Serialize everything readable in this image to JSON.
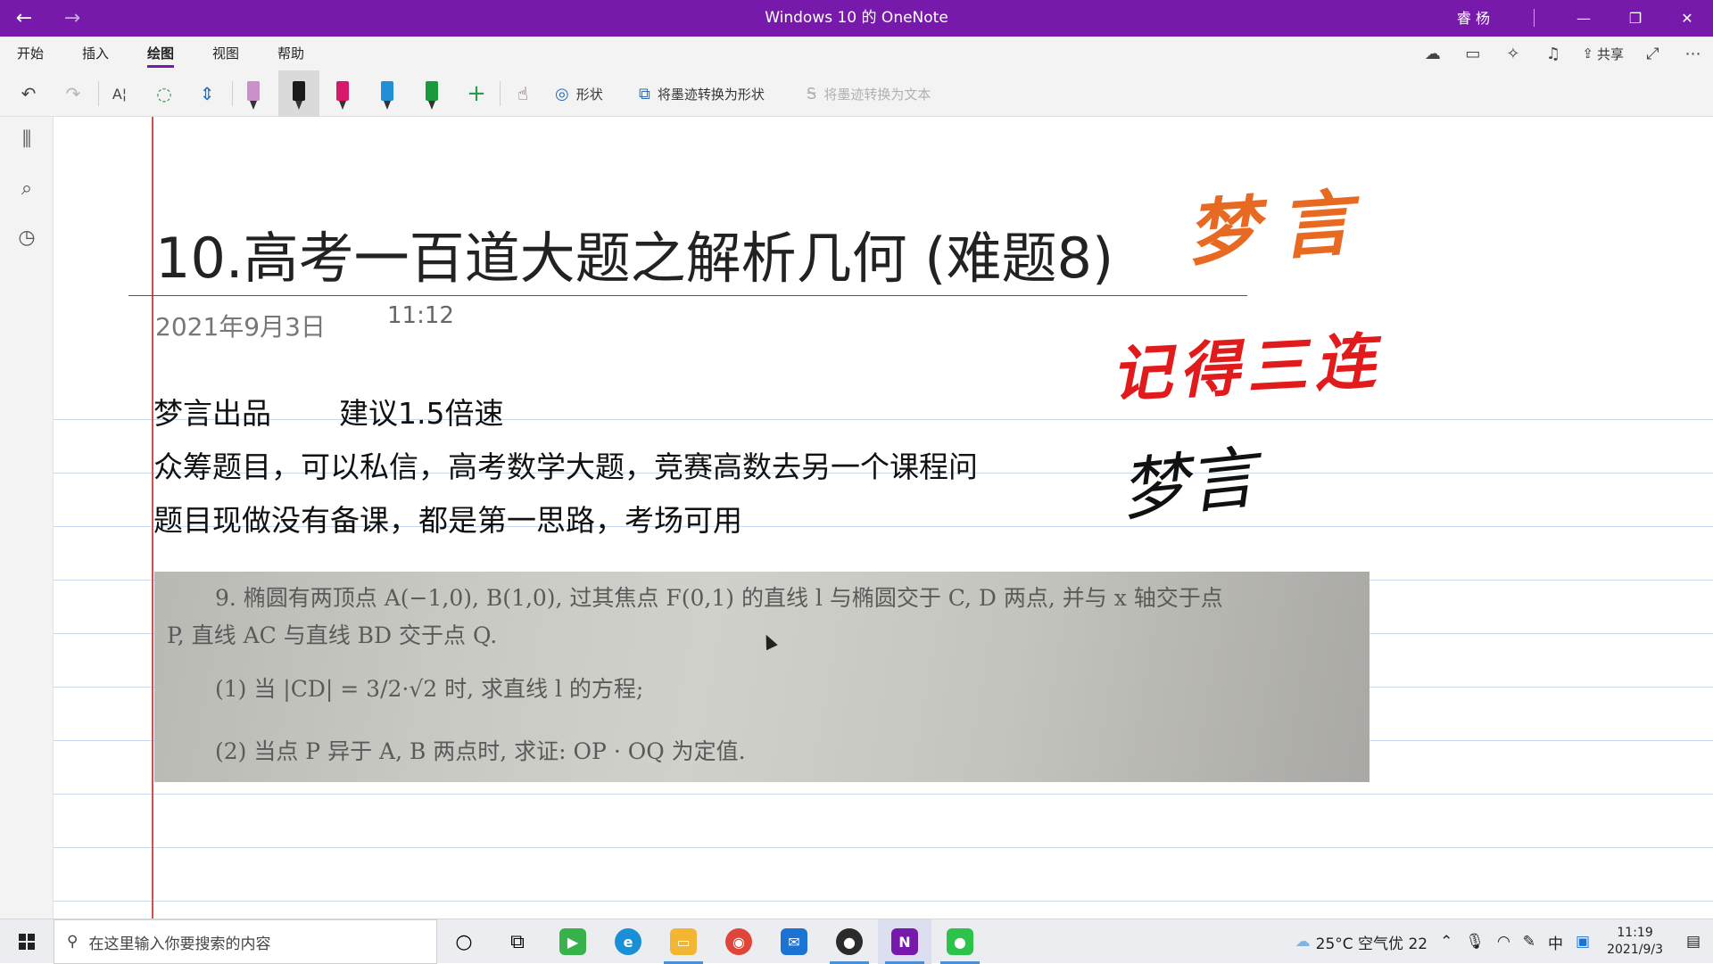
{
  "window": {
    "title": "Windows 10 的 OneNote",
    "user": "睿 杨",
    "back_glyph": "←",
    "forward_glyph": "→",
    "minimize_glyph": "—",
    "maximize_glyph": "❐",
    "close_glyph": "✕"
  },
  "ribbon": {
    "tabs": [
      {
        "label": "开始"
      },
      {
        "label": "插入"
      },
      {
        "label": "绘图",
        "active": true
      },
      {
        "label": "视图"
      },
      {
        "label": "帮助"
      }
    ],
    "share_label": "共享"
  },
  "toolbar": {
    "shapes_label": "形状",
    "ink_to_shape_label": "将墨迹转换为形状",
    "ink_to_text_label": "将墨迹转换为文本",
    "add_pen_glyph": "+",
    "pens": [
      {
        "name": "highlighter",
        "color": "#c990c9"
      },
      {
        "name": "black-pen",
        "color": "#1a1a1a"
      },
      {
        "name": "pink-pen",
        "color": "#d8186a"
      },
      {
        "name": "blue-pen",
        "color": "#1f8fd6"
      },
      {
        "name": "green-pen",
        "color": "#1a9a3c"
      }
    ]
  },
  "page": {
    "title": "10.高考一百道大题之解析几何 (难题8)",
    "date": "2021年9月3日",
    "time": "11:12",
    "lines": [
      {
        "a": "梦言出品",
        "b": "建议1.5倍速"
      },
      {
        "a": "众筹题目，可以私信，高考数学大题，竞赛高数去另一个课程问"
      },
      {
        "a": "题目现做没有备课，都是第一思路，考场可用"
      }
    ],
    "problem_image": {
      "line1": "9. 椭圆有两顶点 A(−1,0), B(1,0), 过其焦点 F(0,1) 的直线 l 与椭圆交于 C, D 两点, 并与 x 轴交于点",
      "line2": "P, 直线 AC 与直线 BD 交于点 Q.",
      "line3": "(1) 当 |CD| = 3/2·√2 时, 求直线 l 的方程;",
      "line4": "(2) 当点 P 异于 A, B 两点时, 求证: OP · OQ 为定值."
    },
    "ink": {
      "top": "梦言",
      "middle": "记得三连",
      "bottom": "梦言"
    },
    "colors": {
      "margin_line": "#d84c4c",
      "rule_line": "#c7d9ef",
      "ink_orange": "#e86a22",
      "ink_red": "#e11b1b"
    }
  },
  "taskbar": {
    "search_placeholder": "在这里输入你要搜索的内容",
    "weather": "25°C 空气优 22",
    "ime": "中",
    "time": "11:19",
    "date": "2021/9/3",
    "accent": "#7719aa"
  }
}
